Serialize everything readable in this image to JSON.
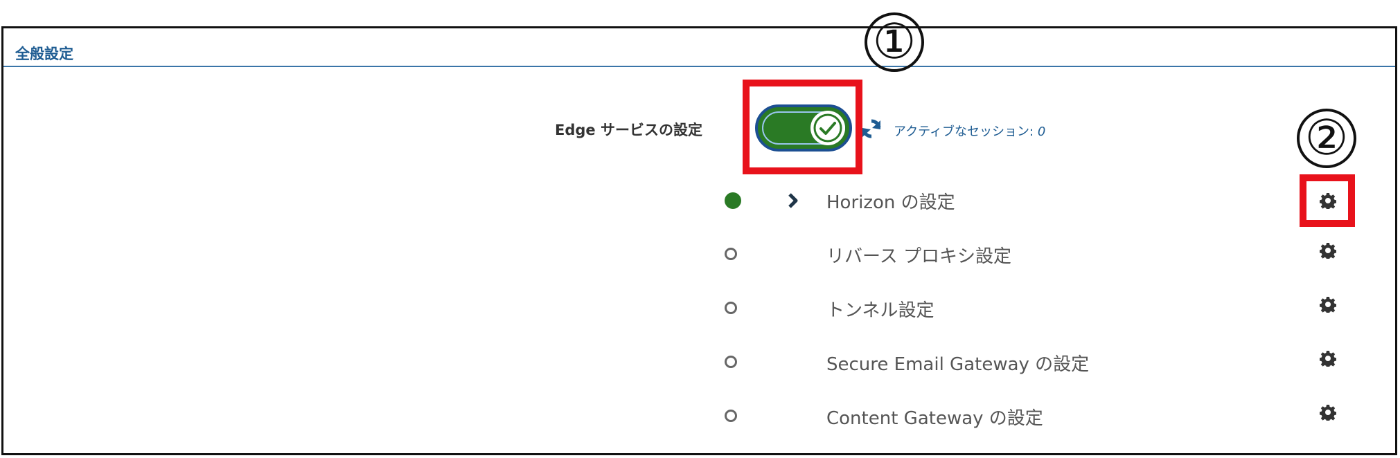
{
  "section": {
    "title": "全般設定"
  },
  "annotations": {
    "marker_1": "①",
    "marker_2": "②"
  },
  "edge_services": {
    "label": "Edge サービスの設定",
    "toggle_state": "on",
    "sessions_label": "アクティブなセッション:",
    "sessions_count": "0"
  },
  "settings": [
    {
      "label": "Horizon の設定",
      "status": "active",
      "expandable": true
    },
    {
      "label": "リバース プロキシ設定",
      "status": "inactive",
      "expandable": false
    },
    {
      "label": "トンネル設定",
      "status": "inactive",
      "expandable": false
    },
    {
      "label": "Secure Email Gateway の設定",
      "status": "inactive",
      "expandable": false
    },
    {
      "label": "Content Gateway の設定",
      "status": "inactive",
      "expandable": false
    }
  ],
  "icons": {
    "toggle": "check-icon",
    "refresh": "refresh-icon",
    "expand": "chevron-right-icon",
    "settings": "gear-icon"
  },
  "colors": {
    "accent_blue": "#1e5c92",
    "active_green": "#2a7a25",
    "highlight_red": "#e8121b"
  }
}
